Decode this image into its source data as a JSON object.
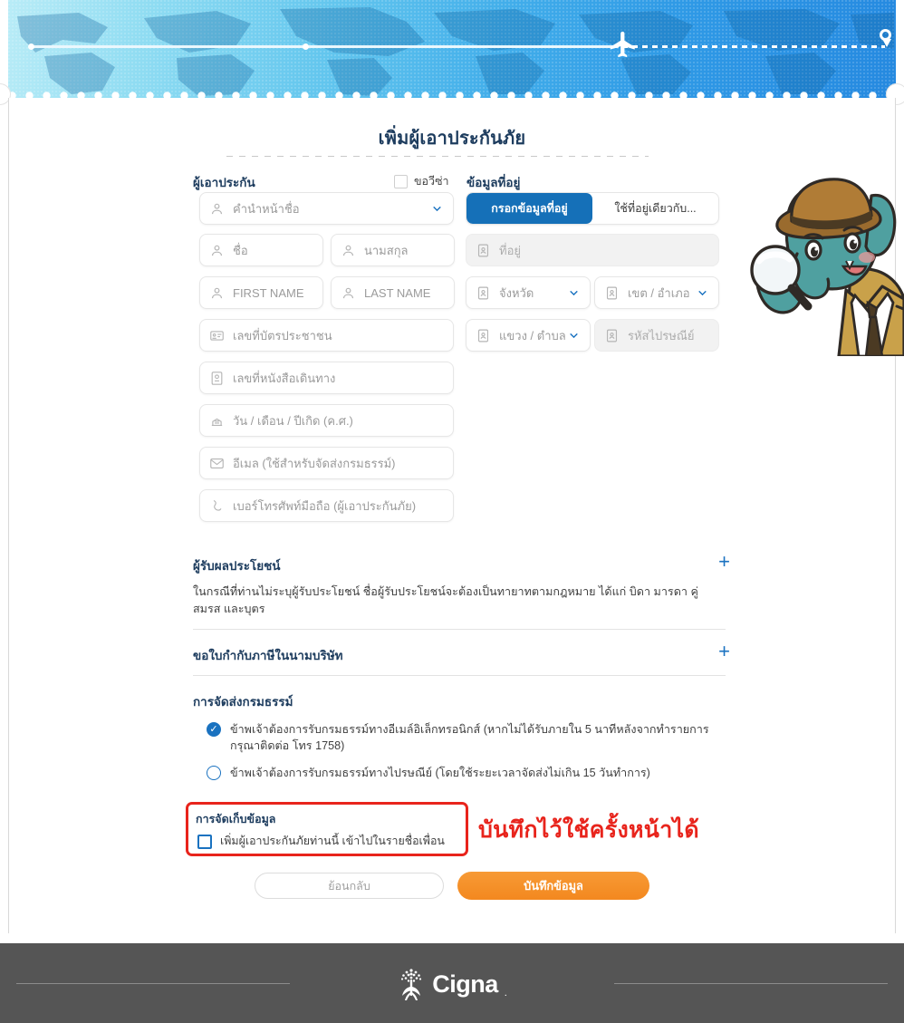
{
  "banner": {
    "icon_plane": "airplane-icon",
    "icon_pin": "map-pin-icon"
  },
  "page_title": "เพิ่มผู้เอาประกันภัย",
  "insured_section": {
    "label": "ผู้เอาประกัน",
    "visa_checkbox_label": "ขอวีซ่า",
    "fields": {
      "title_prefix": "คำนำหน้าชื่อ",
      "first_name_th": "ชื่อ",
      "last_name_th": "นามสกุล",
      "first_name_en": "FIRST NAME",
      "last_name_en": "LAST NAME",
      "id_card": "เลขที่บัตรประชาชน",
      "passport": "เลขที่หนังสือเดินทาง",
      "birth_date": "วัน / เดือน / ปีเกิด (ค.ศ.)",
      "email": "อีเมล (ใช้สำหรับจัดส่งกรมธรรม์)",
      "mobile": "เบอร์โทรศัพท์มือถือ (ผู้เอาประกันภัย)"
    }
  },
  "address_section": {
    "label": "ข้อมูลที่อยู่",
    "tabs": [
      {
        "label": "กรอกข้อมูลที่อยู่",
        "active": true
      },
      {
        "label": "ใช้ที่อยู่เดียวกับ...",
        "active": false
      }
    ],
    "fields": {
      "address": "ที่อยู่",
      "province": "จังหวัด",
      "district": "เขต / อำเภอ",
      "subdistrict": "แขวง / ตำบล",
      "postcode": "รหัสไปรษณีย์"
    }
  },
  "beneficiary_section": {
    "title": "ผู้รับผลประโยชน์",
    "expand_label": "+",
    "description": "ในกรณีที่ท่านไม่ระบุผู้รับประโยชน์ ชื่อผู้รับประโยชน์จะต้องเป็นทายาทตามกฎหมาย ได้แก่ บิดา มารดา คู่สมรส และบุตร"
  },
  "tax_invoice_section": {
    "title": "ขอใบกำกับภาษีในนามบริษัท",
    "expand_label": "+"
  },
  "delivery_section": {
    "title": "การจัดส่งกรมธรรม์",
    "options": [
      {
        "label": "ข้าพเจ้าต้องการรับกรมธรรม์ทางอีเมล์อิเล็กทรอนิกส์ (หากไม่ได้รับภายใน 5 นาทีหลังจากทำรายการ กรุณาติดต่อ โทร 1758)",
        "selected": true
      },
      {
        "label": "ข้าพเจ้าต้องการรับกรมธรรม์ทางไปรษณีย์ (โดยใช้ระยะเวลาจัดส่งไม่เกิน 15 วันทำการ)",
        "selected": false
      }
    ]
  },
  "storage_section": {
    "title": "การจัดเก็บข้อมูล",
    "checkbox_label": "เพิ่มผู้เอาประกันภัยท่านนี้ เข้าไปในรายชื่อเพื่อน",
    "checked": false
  },
  "annotation": {
    "text": "บันทึกไว้ใช้ครั้งหน้าได้",
    "color": "#e8241c"
  },
  "buttons": {
    "back": "ย้อนกลับ",
    "save": "บันทึกข้อมูล"
  },
  "mascot": {
    "name": "elephant-detective-mascot"
  },
  "footer": {
    "brand": "Cigna",
    "registered_mark": "."
  },
  "colors": {
    "primary_blue": "#1570b8",
    "accent_orange": "#f3881f",
    "title_navy": "#1d3c5e",
    "annotation_red": "#e8241c",
    "footer_gray": "#555555"
  }
}
